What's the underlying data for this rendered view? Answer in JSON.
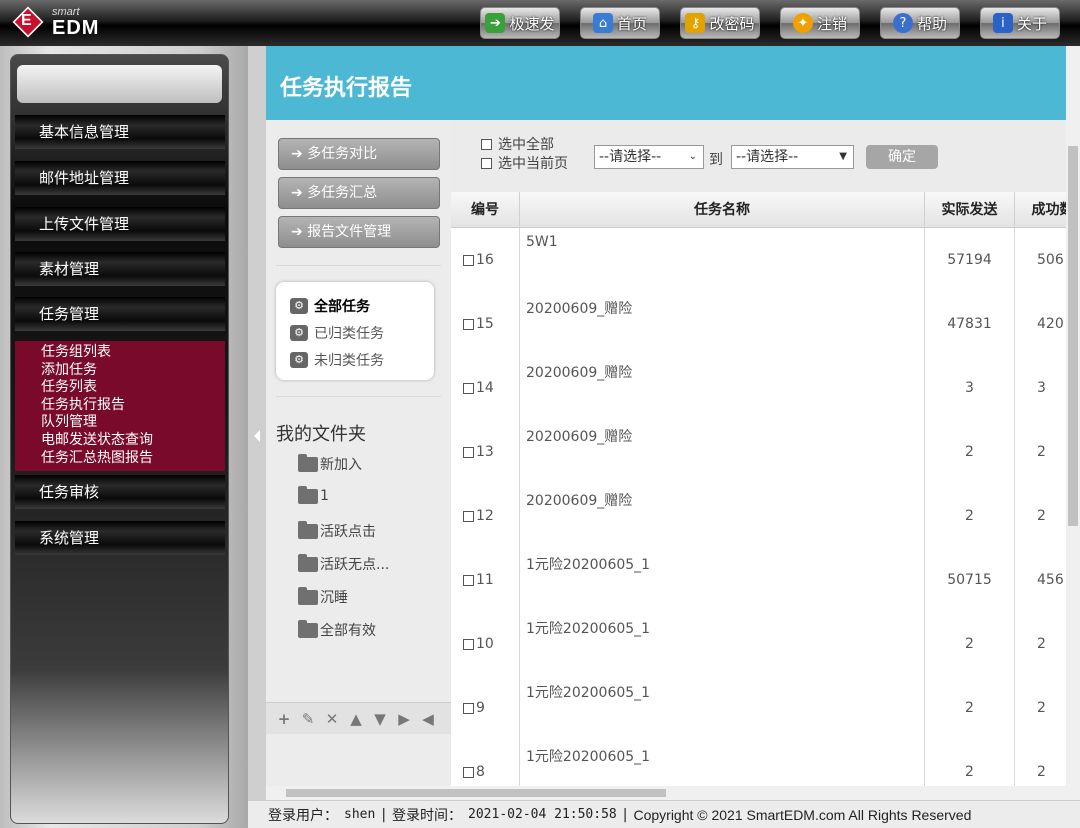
{
  "header": {
    "logo_small": "smart",
    "logo_main": "EDM",
    "nav": [
      {
        "label": "极速发",
        "icon": "arrow-right-icon",
        "color": "#3aa13a"
      },
      {
        "label": "首页",
        "icon": "home-icon",
        "color": "#3a7bd5"
      },
      {
        "label": "改密码",
        "icon": "key-icon",
        "color": "#e0a300"
      },
      {
        "label": "注销",
        "icon": "logout-icon",
        "color": "#f0a000"
      },
      {
        "label": "帮助",
        "icon": "help-icon",
        "color": "#3a6fd0"
      },
      {
        "label": "关于",
        "icon": "info-icon",
        "color": "#2a62c8"
      }
    ]
  },
  "sidebar": {
    "items": [
      {
        "label": "基本信息管理"
      },
      {
        "label": "邮件地址管理"
      },
      {
        "label": "上传文件管理"
      },
      {
        "label": "素材管理"
      },
      {
        "label": "任务管理"
      },
      {
        "label": "任务审核"
      },
      {
        "label": "系统管理"
      }
    ],
    "submenu": [
      "任务组列表",
      "添加任务",
      "任务列表",
      "任务执行报告",
      "队列管理",
      "电邮发送状态查询",
      "任务汇总热图报告"
    ]
  },
  "main": {
    "title": "任务执行报告",
    "actions": [
      "多任务对比",
      "多任务汇总",
      "报告文件管理"
    ],
    "filters": [
      "全部任务",
      "已归类任务",
      "未归类任务"
    ],
    "folders_title": "我的文件夹",
    "folders": [
      "新加入",
      "1",
      "活跃点击",
      "活跃无点...",
      "沉睡",
      "全部有效"
    ],
    "select_all": "选中全部",
    "select_page": "选中当前页",
    "select_placeholder_1": "--请选择--",
    "to": "到",
    "select_placeholder_2": "--请选择--",
    "ok": "确定"
  },
  "table": {
    "headers": [
      "编号",
      "任务名称",
      "实际发送",
      "成功数"
    ],
    "rows": [
      {
        "id": "16",
        "name": "5W1",
        "sent": "57194",
        "succ": "506"
      },
      {
        "id": "15",
        "name": "20200609_赠险",
        "sent": "47831",
        "succ": "420"
      },
      {
        "id": "14",
        "name": "20200609_赠险",
        "sent": "3",
        "succ": "3"
      },
      {
        "id": "13",
        "name": "20200609_赠险",
        "sent": "2",
        "succ": "2"
      },
      {
        "id": "12",
        "name": "20200609_赠险",
        "sent": "2",
        "succ": "2"
      },
      {
        "id": "11",
        "name": "1元险20200605_1",
        "sent": "50715",
        "succ": "456"
      },
      {
        "id": "10",
        "name": "1元险20200605_1",
        "sent": "2",
        "succ": "2"
      },
      {
        "id": "9",
        "name": "1元险20200605_1",
        "sent": "2",
        "succ": "2"
      },
      {
        "id": "8",
        "name": "1元险20200605_1",
        "sent": "2",
        "succ": "2"
      }
    ]
  },
  "status": {
    "user_label": "登录用户：",
    "user": "shen",
    "time_label": "登录时间：",
    "time": "2021-02-04 21:50:58",
    "copyright": "Copyright © 2021 SmartEDM.com All Rights Reserved"
  }
}
